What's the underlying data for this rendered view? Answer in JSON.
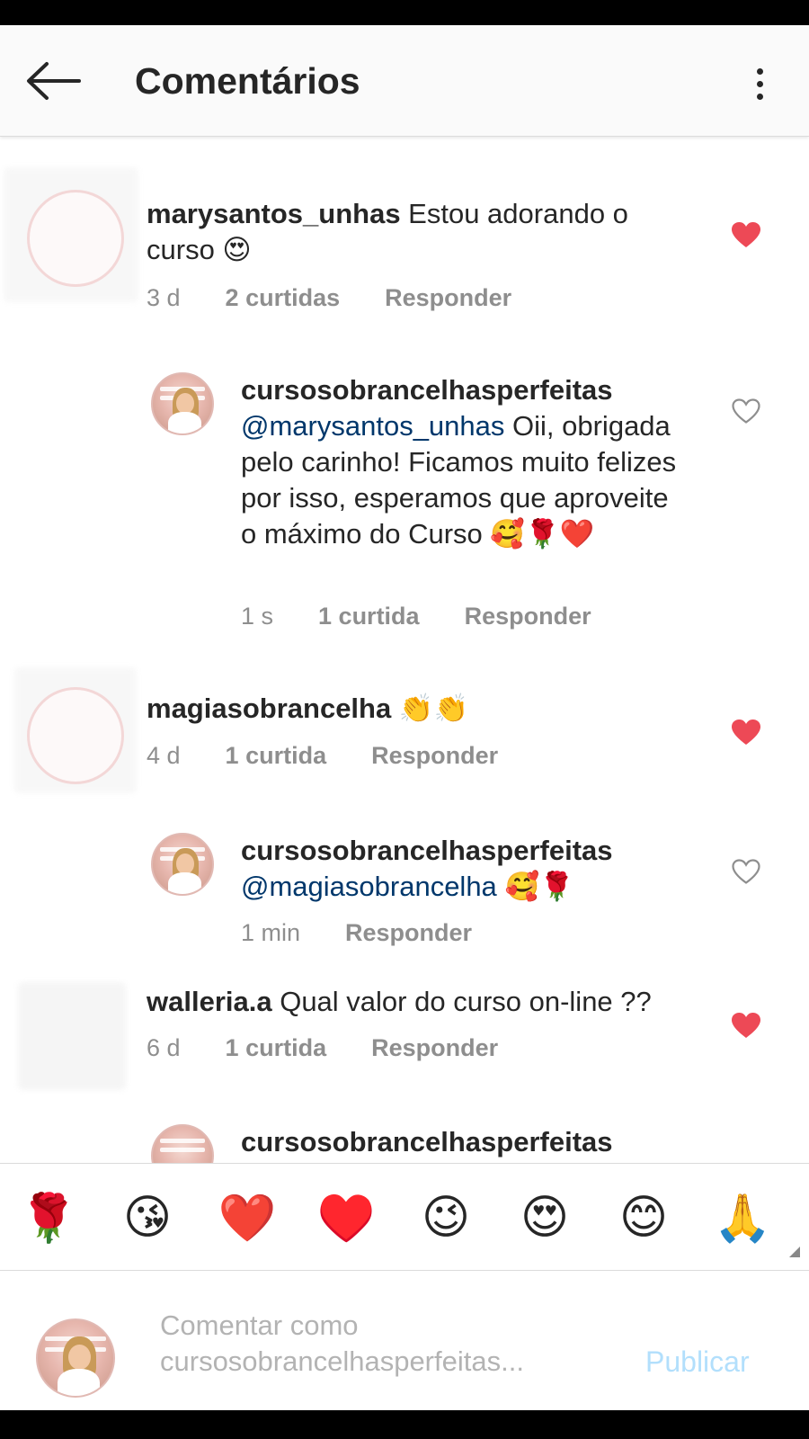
{
  "header": {
    "title": "Comentários",
    "back_icon": "arrow-left-icon",
    "more_icon": "more-vertical-icon"
  },
  "comments": [
    {
      "username": "marysantos_unhas",
      "text": " Estou adorando o curso ",
      "emoji": "😍",
      "time": "3 d",
      "likes": "2 curtidas",
      "reply": "Responder",
      "liked": true
    },
    {
      "username": "cursosobrancelhasperfeitas",
      "mention": "@marysantos_unhas",
      "text": " Oii, obrigada pelo carinho! Ficamos muito felizes por isso, esperamos que aproveite o máximo do Curso ",
      "emoji": "🥰🌹❤️",
      "time": "1 s",
      "likes": "1 curtida",
      "reply": "Responder",
      "liked": false
    },
    {
      "username": "magiasobrancelha",
      "text": " ",
      "emoji": "👏👏",
      "time": "4 d",
      "likes": "1 curtida",
      "reply": "Responder",
      "liked": true
    },
    {
      "username": "cursosobrancelhasperfeitas",
      "mention": "@magiasobrancelha",
      "text": " ",
      "emoji": "🥰🌹",
      "time": "1 min",
      "reply": "Responder",
      "liked": false
    },
    {
      "username": "walleria.a",
      "text": " Qual valor do curso on-line ??",
      "time": "6 d",
      "likes": "1 curtida",
      "reply": "Responder",
      "liked": true
    },
    {
      "username": "cursosobrancelhasperfeitas"
    }
  ],
  "emoji_bar": [
    "🌹",
    "😘",
    "❤️",
    "♥️",
    "😉",
    "😍",
    "😊",
    "🙏"
  ],
  "composer": {
    "placeholder": "Comentar como cursosobrancelhasperfeitas...",
    "publish_label": "Publicar"
  },
  "colors": {
    "heart_liked": "#ed4956",
    "heart_outline": "#8e8e8e",
    "mention": "#00376b",
    "publish_disabled": "#b2dffc"
  }
}
